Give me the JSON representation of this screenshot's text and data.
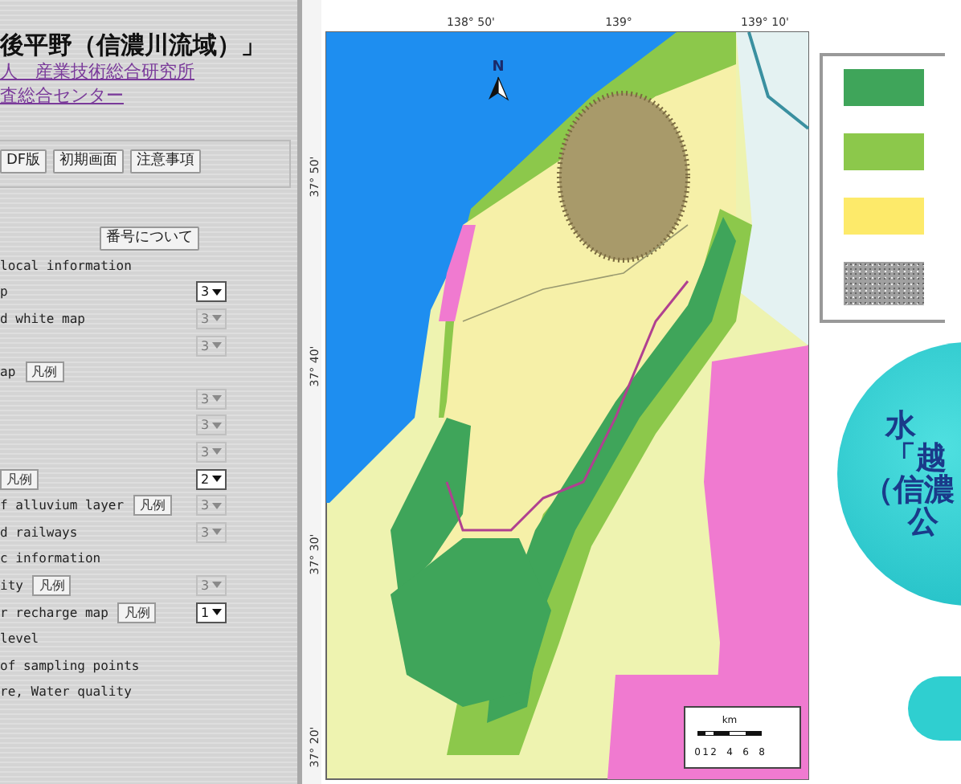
{
  "panel": {
    "title": "後平野（信濃川流域）」",
    "links": [
      "人　産業技術総合研究所",
      "査総合センター"
    ],
    "buttons": [
      "DF版",
      "初期画面",
      "注意事項"
    ],
    "about_button": "番号について",
    "rows": [
      {
        "label": "local information"
      },
      {
        "label": "p",
        "select": {
          "value": "3",
          "disabled": false
        }
      },
      {
        "label": "d white map",
        "select": {
          "value": "3",
          "disabled": true
        }
      },
      {
        "select": {
          "value": "3",
          "disabled": true
        }
      },
      {
        "label": "ap",
        "legend_button": "凡例"
      },
      {
        "select": {
          "value": "3",
          "disabled": true
        }
      },
      {
        "select": {
          "value": "3",
          "disabled": true
        }
      },
      {
        "select": {
          "value": "3",
          "disabled": true
        }
      },
      {
        "legend_button": "凡例",
        "select": {
          "value": "2",
          "disabled": false
        }
      },
      {
        "label": "f alluvium layer",
        "legend_button": "凡例",
        "select": {
          "value": "3",
          "disabled": true
        }
      },
      {
        "label": "d railways",
        "select": {
          "value": "3",
          "disabled": true
        }
      },
      {
        "label": "c information"
      },
      {
        "label": "ity",
        "legend_button": "凡例",
        "select": {
          "value": "3",
          "disabled": true
        }
      },
      {
        "label": "r recharge map",
        "legend_button": "凡例",
        "select": {
          "value": "1",
          "disabled": false
        }
      },
      {
        "label": "level"
      },
      {
        "label": "of sampling points"
      },
      {
        "label": "re, Water quality"
      }
    ]
  },
  "map": {
    "lon_labels": [
      "138° 50'",
      "139°",
      "139° 10'"
    ],
    "lat_labels": [
      "37° 50'",
      "37° 40'",
      "37° 30'",
      "37° 20'"
    ],
    "north": "N",
    "scale": {
      "unit": "km",
      "ticks": [
        "0",
        "1",
        "2",
        "4",
        "6",
        "8"
      ]
    }
  },
  "legend": {
    "swatches": [
      {
        "kind": "fill",
        "color": "#3fa55a"
      },
      {
        "kind": "fill",
        "color": "#8cc84b"
      },
      {
        "kind": "fill",
        "color": "#fdea6a"
      },
      {
        "kind": "pattern",
        "color": "#a0a0a0"
      }
    ]
  },
  "badge": {
    "lines": [
      "水",
      "「越",
      "（信濃",
      "公"
    ]
  }
}
